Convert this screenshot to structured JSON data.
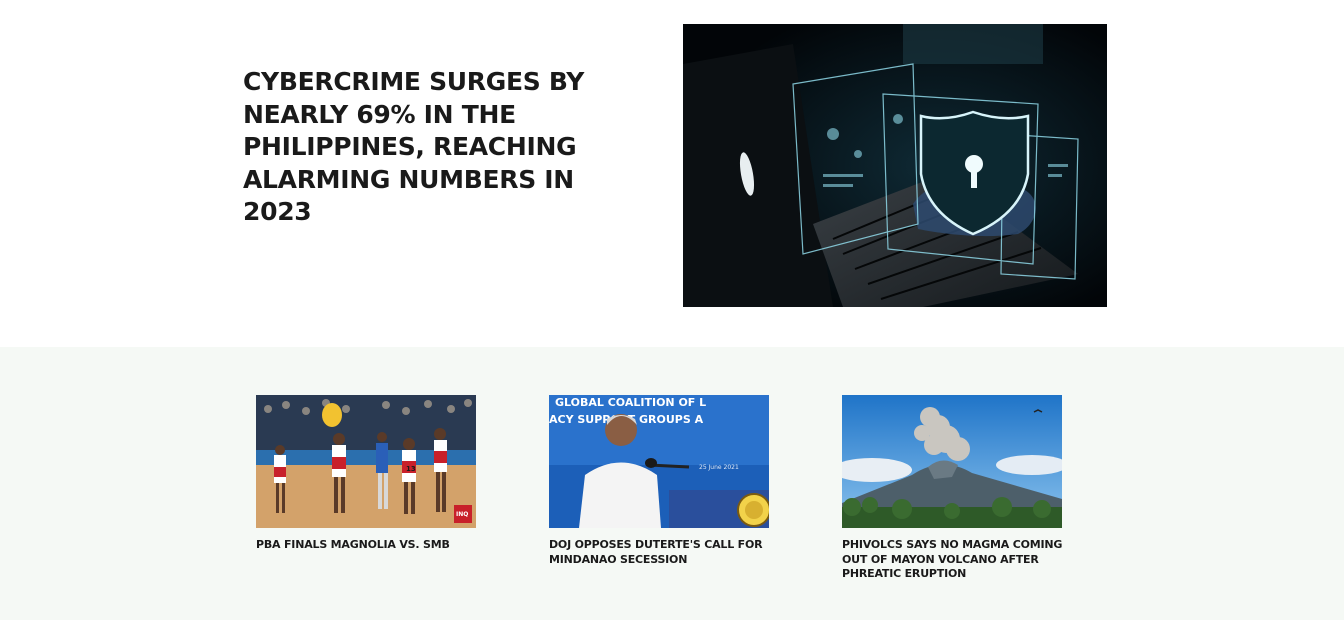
{
  "hero": {
    "title": "CYBERCRIME SURGES BY NEARLY 69% IN THE PHILIPPINES, REACHING ALARMING NUMBERS IN 2023",
    "image_subject": "hands typing on a laptop in the dark with a glowing shield and keyhole security overlay"
  },
  "related": {
    "items": [
      {
        "title": "PBA FINALS MAGNOLIA VS. SMB",
        "image_subject": "basketball players in red and white jerseys on court with blue-uniformed opponents and crowd",
        "image_badge": "INQ"
      },
      {
        "title": "DOJ OPPOSES DUTERTE'S CALL FOR MINDANAO SECESSION",
        "image_subject": "man in white barong speaking at a podium with presidential seal in front of a blue backdrop",
        "backdrop_text": [
          "GLOBAL COALITION OF L",
          "ACY SUPPORT GROUPS A",
          "25 June 2021"
        ]
      },
      {
        "title": "PHIVOLCS SAYS NO MAGMA COMING OUT OF MAYON VOLCANO AFTER PHREATIC ERUPTION",
        "image_subject": "volcano emitting a tall ash plume against a blue sky with green trees in foreground"
      }
    ]
  },
  "colors": {
    "text": "#1a1a1a",
    "page_background": "#ffffff",
    "related_background": "#f5f9f5"
  }
}
